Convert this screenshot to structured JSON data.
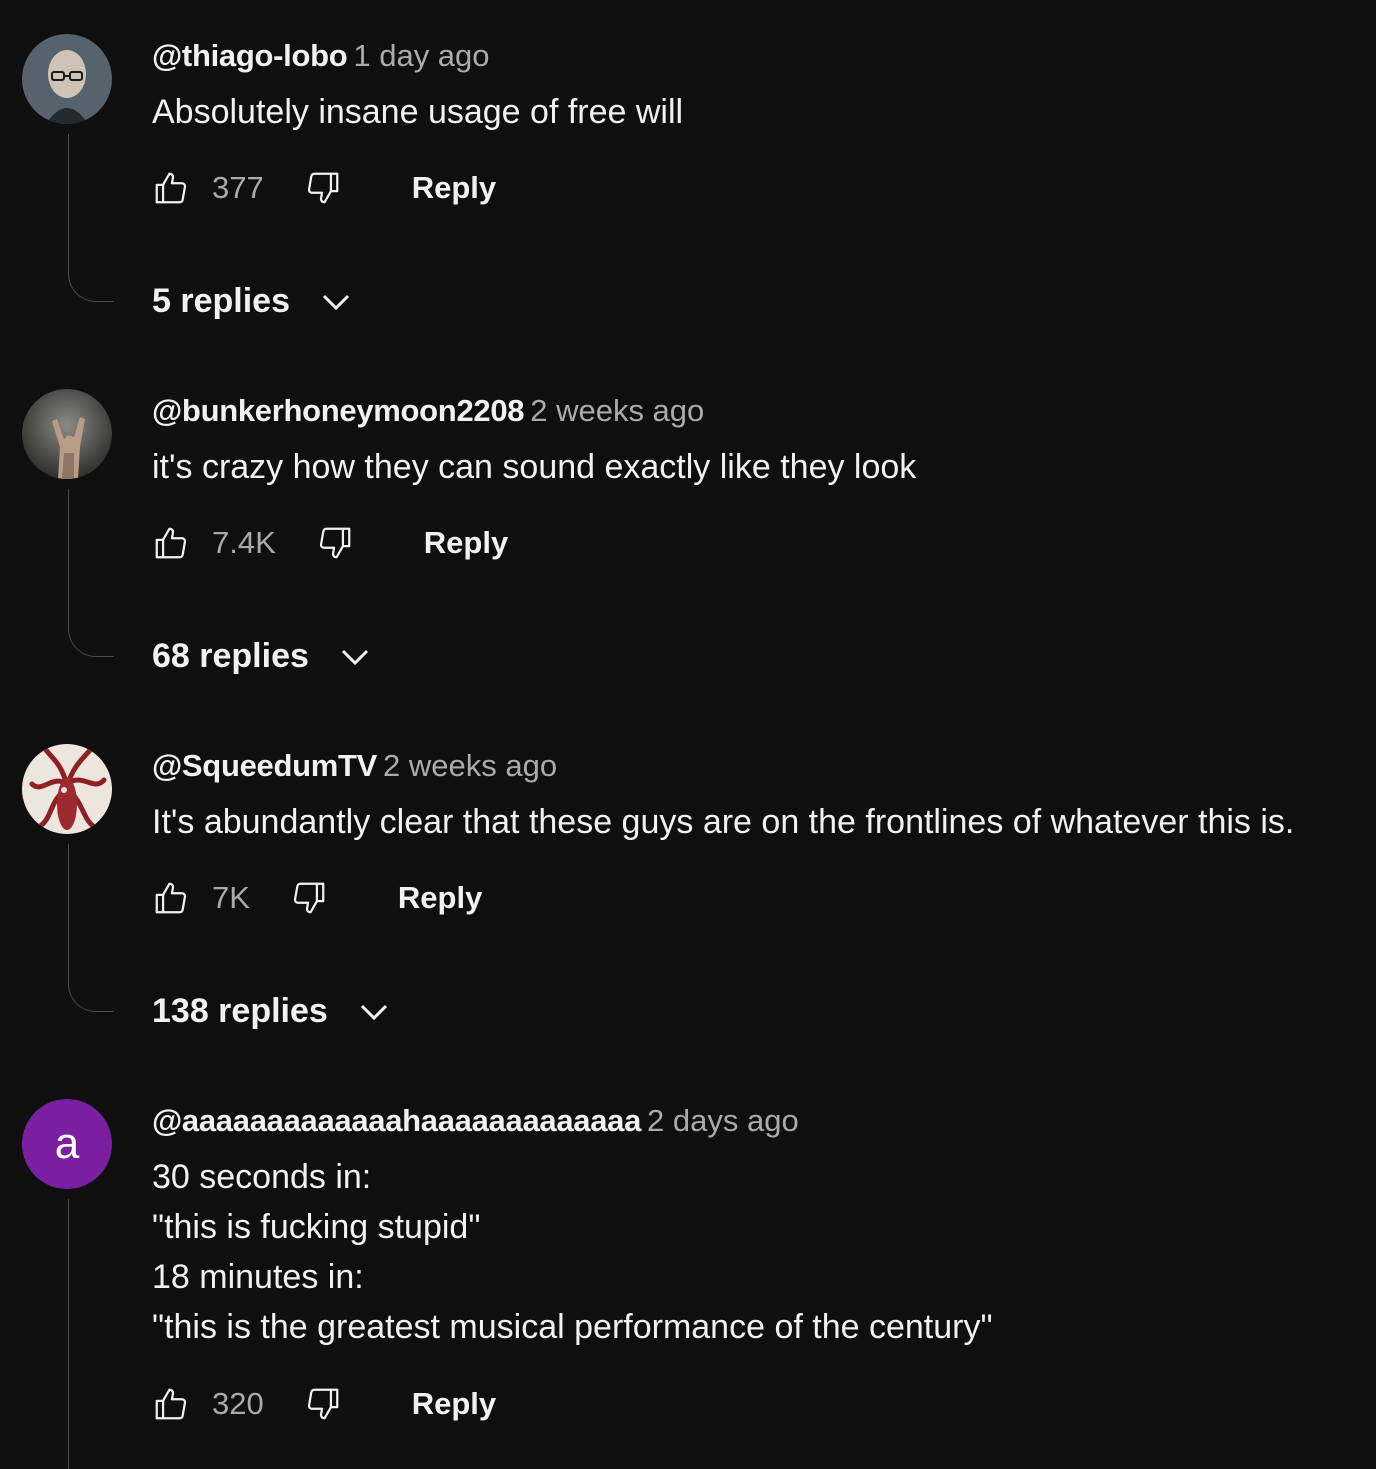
{
  "comments": [
    {
      "author": "@thiago-lobo",
      "time": "1 day ago",
      "text_lines": [
        "Absolutely insane usage of free will"
      ],
      "likes": "377",
      "reply_label": "Reply",
      "replies_label": "5 replies",
      "avatar_icon": "portrait-glasses-avatar"
    },
    {
      "author": "@bunkerhoneymoon2208",
      "time": "2 weeks ago",
      "text_lines": [
        "it's crazy how they can sound exactly like they look"
      ],
      "likes": "7.4K",
      "reply_label": "Reply",
      "replies_label": "68 replies",
      "avatar_icon": "rock-hand-avatar"
    },
    {
      "author": "@SqueedumTV",
      "time": "2 weeks ago",
      "text_lines": [
        "It's abundantly clear that these guys are on the frontlines of whatever this is."
      ],
      "likes": "7K",
      "reply_label": "Reply",
      "replies_label": "138 replies",
      "avatar_icon": "squid-avatar"
    },
    {
      "author": "@aaaaaaaaaaaaahaaaaaaaaaaaaa",
      "time": "2 days ago",
      "text_lines": [
        "30 seconds in:",
        "\"this is fucking stupid\"",
        "18 minutes in:",
        "\"this is the greatest musical performance of the century\""
      ],
      "likes": "320",
      "reply_label": "Reply",
      "avatar_letter": "a",
      "avatar_color": "#7b1fa2"
    }
  ]
}
